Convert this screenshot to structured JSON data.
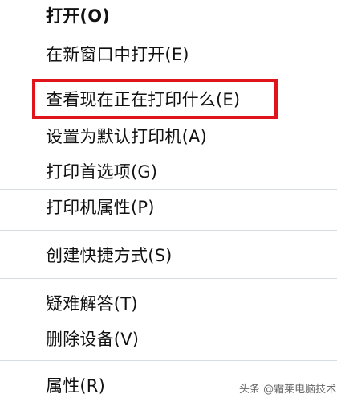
{
  "context_menu": {
    "items": [
      {
        "label": "打开(O)"
      },
      {
        "label": "在新窗口中打开(E)"
      },
      {
        "label": "查看现在正在打印什么(E)"
      },
      {
        "label": "设置为默认打印机(A)"
      },
      {
        "label": "打印首选项(G)"
      },
      {
        "label": "打印机属性(P)"
      },
      {
        "label": "创建快捷方式(S)"
      },
      {
        "label": "疑难解答(T)"
      },
      {
        "label": "删除设备(V)"
      },
      {
        "label": "属性(R)"
      }
    ],
    "highlight_color": "#e0141b"
  },
  "watermark": {
    "text": "头条 @霜莱电脑技术"
  }
}
